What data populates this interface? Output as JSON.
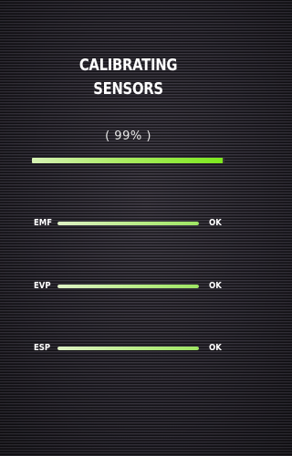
{
  "title": {
    "line1": "CALIBRATING",
    "line2": "SENSORS"
  },
  "progress": {
    "label": "( 99% )",
    "value": 0.99
  },
  "sensors": [
    {
      "name": "EMF",
      "status": "OK",
      "level": 1.0
    },
    {
      "name": "EVP",
      "status": "OK",
      "level": 1.0
    },
    {
      "name": "ESP",
      "status": "OK",
      "level": 1.0
    }
  ],
  "colors": {
    "background": "#2b2830",
    "bar_fill": "#7de81e",
    "sensor_fill": "#b8ec86",
    "text": "#ffffff"
  }
}
